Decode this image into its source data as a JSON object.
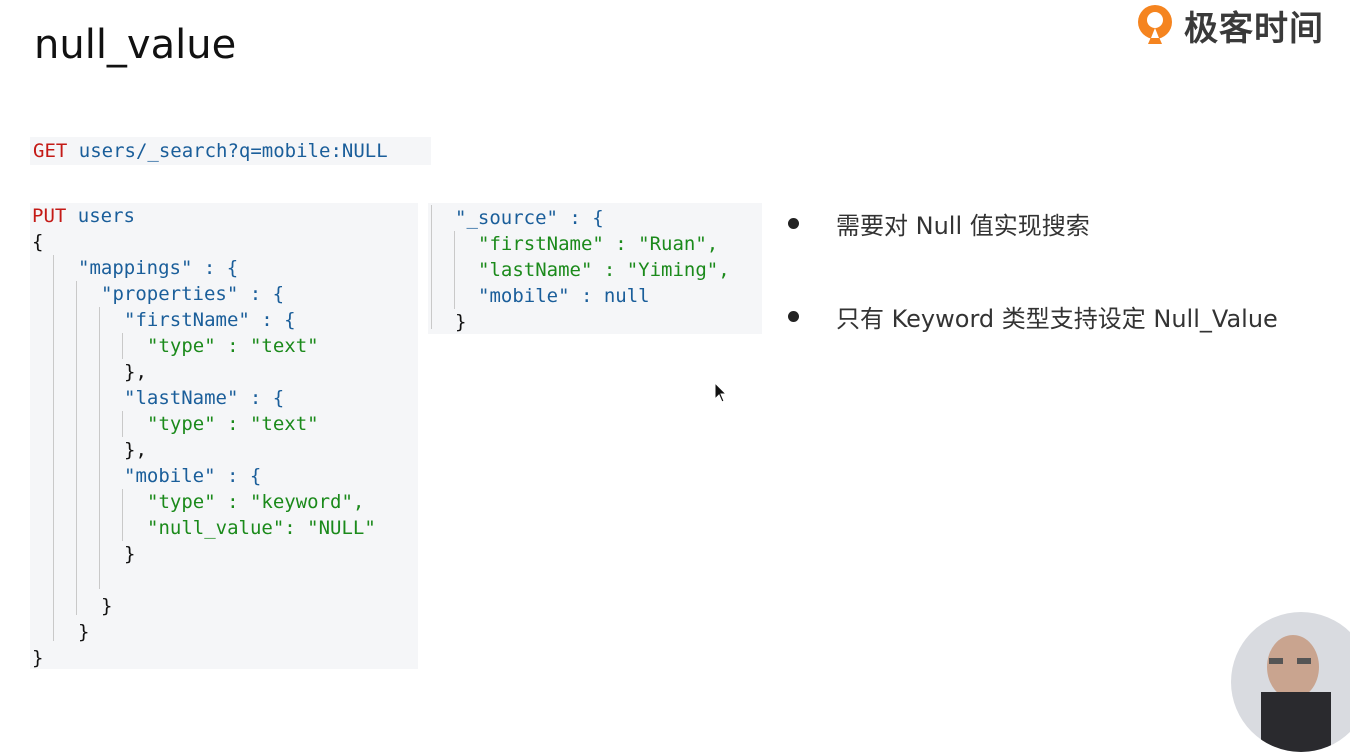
{
  "slide": {
    "title": "null_value",
    "brand_name": "极客时间",
    "get_query": {
      "method": "GET",
      "path": "users/_search?q=mobile:NULL"
    },
    "put_block": {
      "method": "PUT",
      "index": "users",
      "lines": [
        "{",
        "\"mappings\" : {",
        "\"properties\" : {",
        "\"firstName\" : {",
        "\"type\" : \"text\"",
        "},",
        "\"lastName\" : {",
        "\"type\" : \"text\"",
        "},",
        "\"mobile\" : {",
        "\"type\" : \"keyword\",",
        "\"null_value\": \"NULL\"",
        "}",
        "}",
        "}",
        "}"
      ]
    },
    "source_block": {
      "lines": [
        "\"_source\" : {",
        "\"firstName\" : \"Ruan\",",
        "\"lastName\" : \"Yiming\",",
        "\"mobile\" : null",
        "}"
      ]
    },
    "bullets": [
      "需要对 Null 值实现搜索",
      "只有 Keyword 类型支持设定 Null_Value"
    ]
  },
  "colors": {
    "keyword_red": "#c41a16",
    "key_blue": "#1a5e9a",
    "string_green": "#1b8a1b",
    "code_bg": "#f5f6f8",
    "brand_orange": "#f5841f"
  },
  "icons": [
    "geekbang-logo-icon",
    "mouse-cursor-icon",
    "presenter-avatar"
  ]
}
